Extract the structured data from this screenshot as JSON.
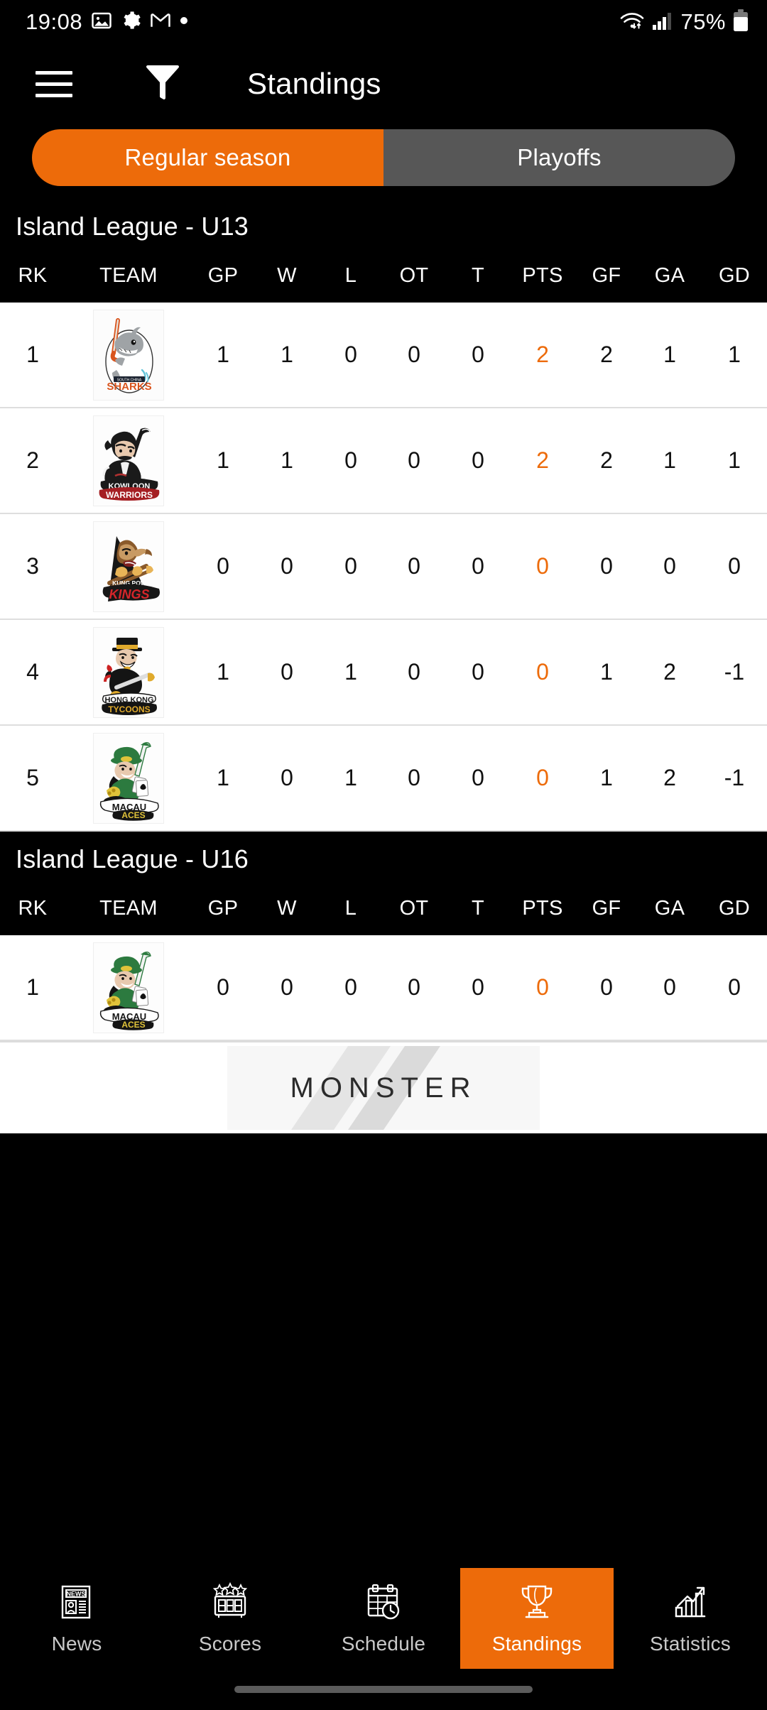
{
  "status_bar": {
    "time": "19:08",
    "battery_percent": "75%",
    "icons": [
      "photo-icon",
      "gear-icon",
      "gmail-icon",
      "dot-icon",
      "wifi-icon",
      "cellular-signal-icon",
      "battery-icon"
    ]
  },
  "app_bar": {
    "menu_icon": "hamburger-menu-icon",
    "filter_icon": "funnel-filter-icon",
    "title": "Standings"
  },
  "segmented_control": {
    "active_index": 0,
    "tabs": [
      {
        "label": "Regular season",
        "active": true
      },
      {
        "label": "Playoffs",
        "active": false
      }
    ]
  },
  "columns": [
    "RK",
    "TEAM",
    "GP",
    "W",
    "L",
    "OT",
    "T",
    "PTS",
    "GF",
    "GA",
    "GD"
  ],
  "sections": [
    {
      "title": "Island League - U13",
      "rows": [
        {
          "rk": "1",
          "team": "South China Sharks",
          "logo": "south-china-sharks-logo",
          "gp": "1",
          "w": "1",
          "l": "0",
          "ot": "0",
          "t": "0",
          "pts": "2",
          "gf": "2",
          "ga": "1",
          "gd": "1"
        },
        {
          "rk": "2",
          "team": "Kowloon Warriors",
          "logo": "kowloon-warriors-logo",
          "gp": "1",
          "w": "1",
          "l": "0",
          "ot": "0",
          "t": "0",
          "pts": "2",
          "gf": "2",
          "ga": "1",
          "gd": "1"
        },
        {
          "rk": "3",
          "team": "Kung Pow Kings",
          "logo": "kung-pow-kings-logo",
          "gp": "0",
          "w": "0",
          "l": "0",
          "ot": "0",
          "t": "0",
          "pts": "0",
          "gf": "0",
          "ga": "0",
          "gd": "0"
        },
        {
          "rk": "4",
          "team": "Hong Kong Tycoons",
          "logo": "hong-kong-tycoons-logo",
          "gp": "1",
          "w": "0",
          "l": "1",
          "ot": "0",
          "t": "0",
          "pts": "0",
          "gf": "1",
          "ga": "2",
          "gd": "-1"
        },
        {
          "rk": "5",
          "team": "Macau Aces",
          "logo": "macau-aces-logo",
          "gp": "1",
          "w": "0",
          "l": "1",
          "ot": "0",
          "t": "0",
          "pts": "0",
          "gf": "1",
          "ga": "2",
          "gd": "-1"
        }
      ]
    },
    {
      "title": "Island League - U16",
      "rows": [
        {
          "rk": "1",
          "team": "Macau Aces",
          "logo": "macau-aces-logo",
          "gp": "0",
          "w": "0",
          "l": "0",
          "ot": "0",
          "t": "0",
          "pts": "0",
          "gf": "0",
          "ga": "0",
          "gd": "0"
        }
      ]
    }
  ],
  "ad_banner": {
    "brand": "MONSTER",
    "name": "monster-ad-banner"
  },
  "bottom_nav": {
    "active_index": 3,
    "items": [
      {
        "label": "News",
        "icon": "newspaper-icon",
        "active": false
      },
      {
        "label": "Scores",
        "icon": "scoreboard-icon",
        "active": false
      },
      {
        "label": "Schedule",
        "icon": "calendar-clock-icon",
        "active": false
      },
      {
        "label": "Standings",
        "icon": "trophy-icon",
        "active": true
      },
      {
        "label": "Statistics",
        "icon": "bar-chart-icon",
        "active": false
      }
    ]
  },
  "colors": {
    "accent": "#ED6B0A",
    "inactive_tab": "#575757",
    "header_bg": "#000000",
    "row_bg": "#FFFFFF",
    "row_divider": "#DEDEDE"
  }
}
